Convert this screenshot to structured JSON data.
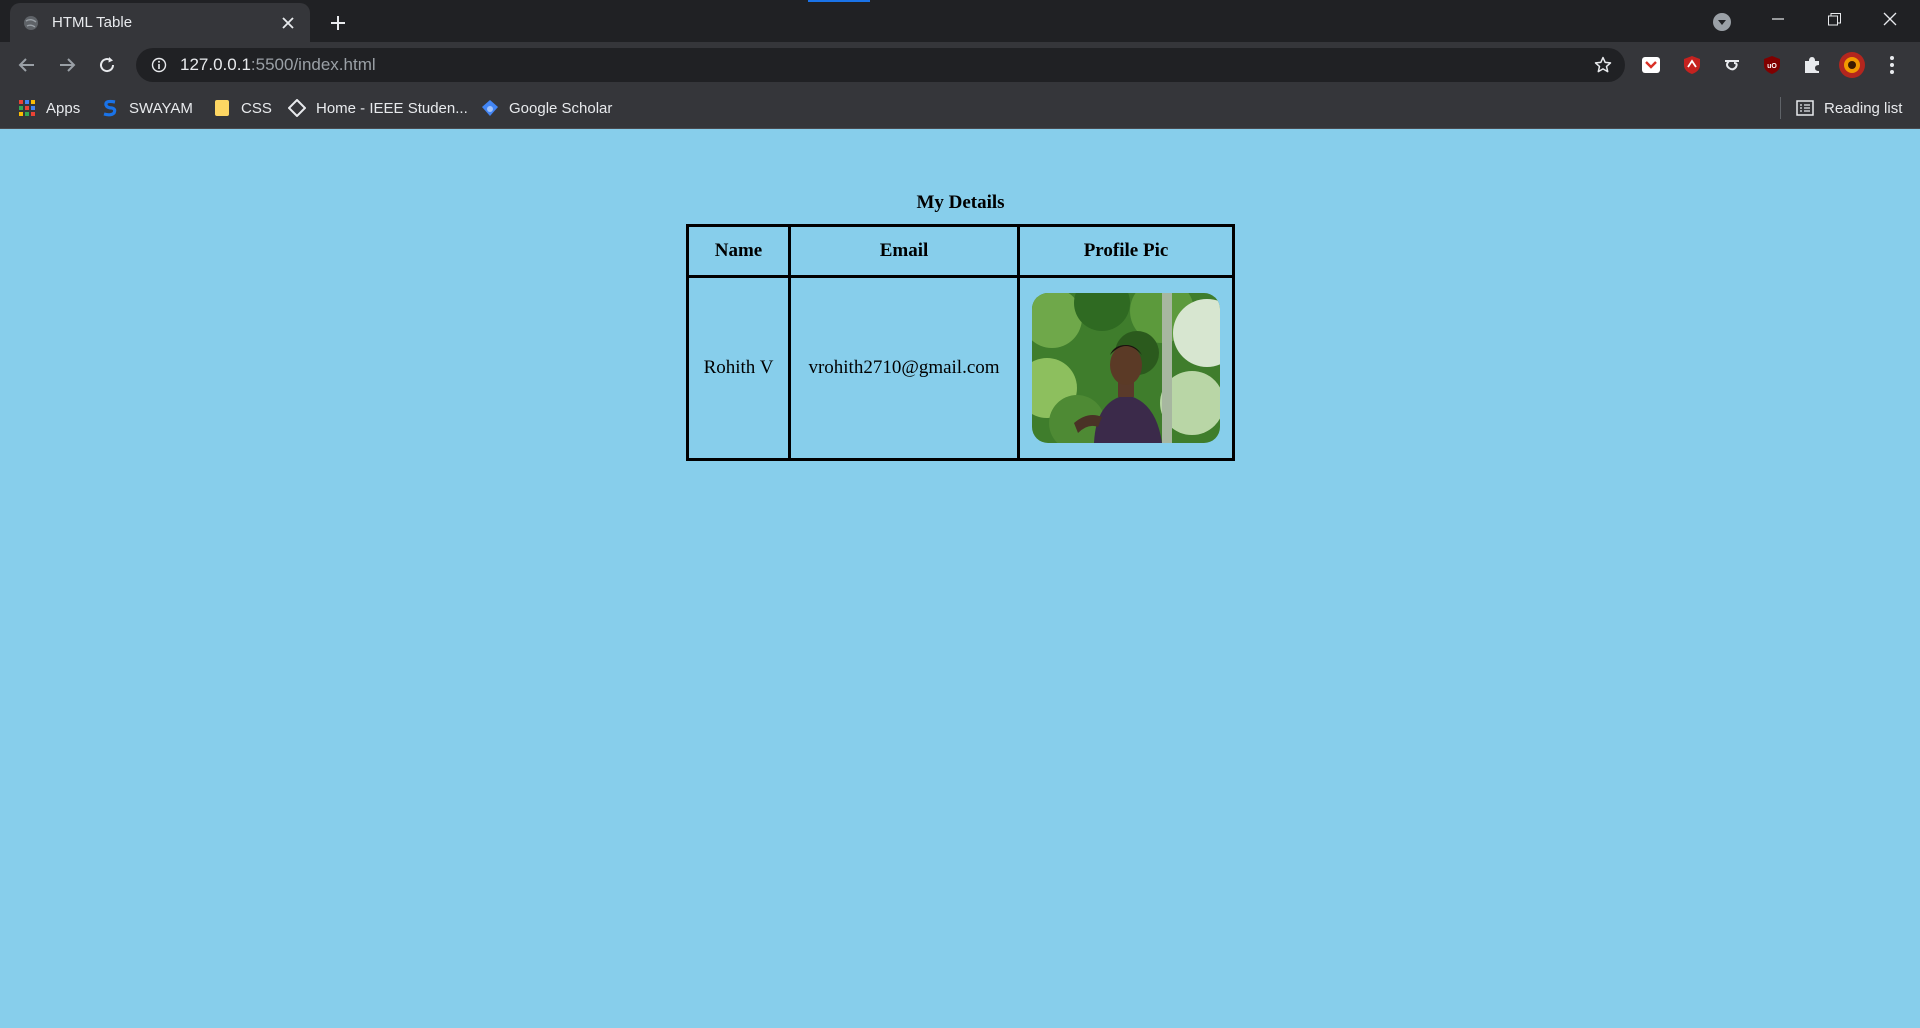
{
  "browser": {
    "tab": {
      "title": "HTML Table"
    },
    "url": {
      "host": "127.0.0.1",
      "rest": ":5500/index.html"
    },
    "bookmarks": [
      {
        "label": "Apps",
        "icon": "apps-grid-icon"
      },
      {
        "label": "SWAYAM",
        "icon": "swayam-icon"
      },
      {
        "label": "CSS",
        "icon": "folder-icon"
      },
      {
        "label": "Home - IEEE Studen...",
        "icon": "diamond-icon"
      },
      {
        "label": "Google Scholar",
        "icon": "scholar-icon"
      }
    ],
    "reading_list": "Reading list",
    "colors": {
      "tabstrip": "#202124",
      "toolbar": "#35363a",
      "page_background": "#87ceeb"
    }
  },
  "page": {
    "table": {
      "caption": "My Details",
      "headers": [
        "Name",
        "Email",
        "Profile Pic"
      ],
      "rows": [
        {
          "name": "Rohith V",
          "email": "vrohith2710@gmail.com",
          "pic": "profile-photo"
        }
      ]
    }
  }
}
